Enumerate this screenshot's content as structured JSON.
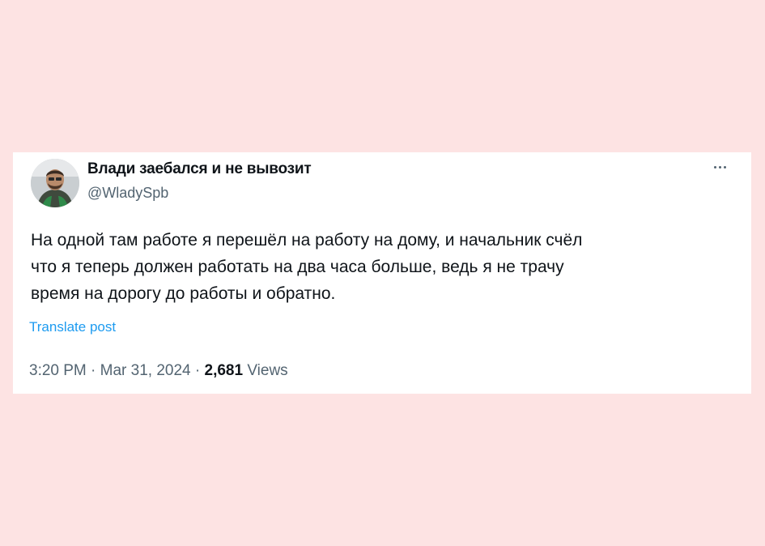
{
  "tweet": {
    "author_name": "Влади заебался и не вывозит",
    "author_handle": "@WladySpb",
    "more_icon": "more-horizontal-icon",
    "text_lines": [
      "На одной там работе я перешёл на работу на дому, и начальник счёл",
      "что я теперь должен работать на два часа больше, ведь я не трачу",
      "время на дорогу до работы и обратно."
    ],
    "translate_label": "Translate post",
    "time": "3:20 PM",
    "date": "Mar 31, 2024",
    "separator": "·",
    "views_count": "2,681",
    "views_label": "Views"
  },
  "colors": {
    "page_background": "#fde3e3",
    "card_background": "#ffffff",
    "primary_text": "#0f1419",
    "secondary_text": "#536471",
    "link": "#1d9bf0"
  }
}
